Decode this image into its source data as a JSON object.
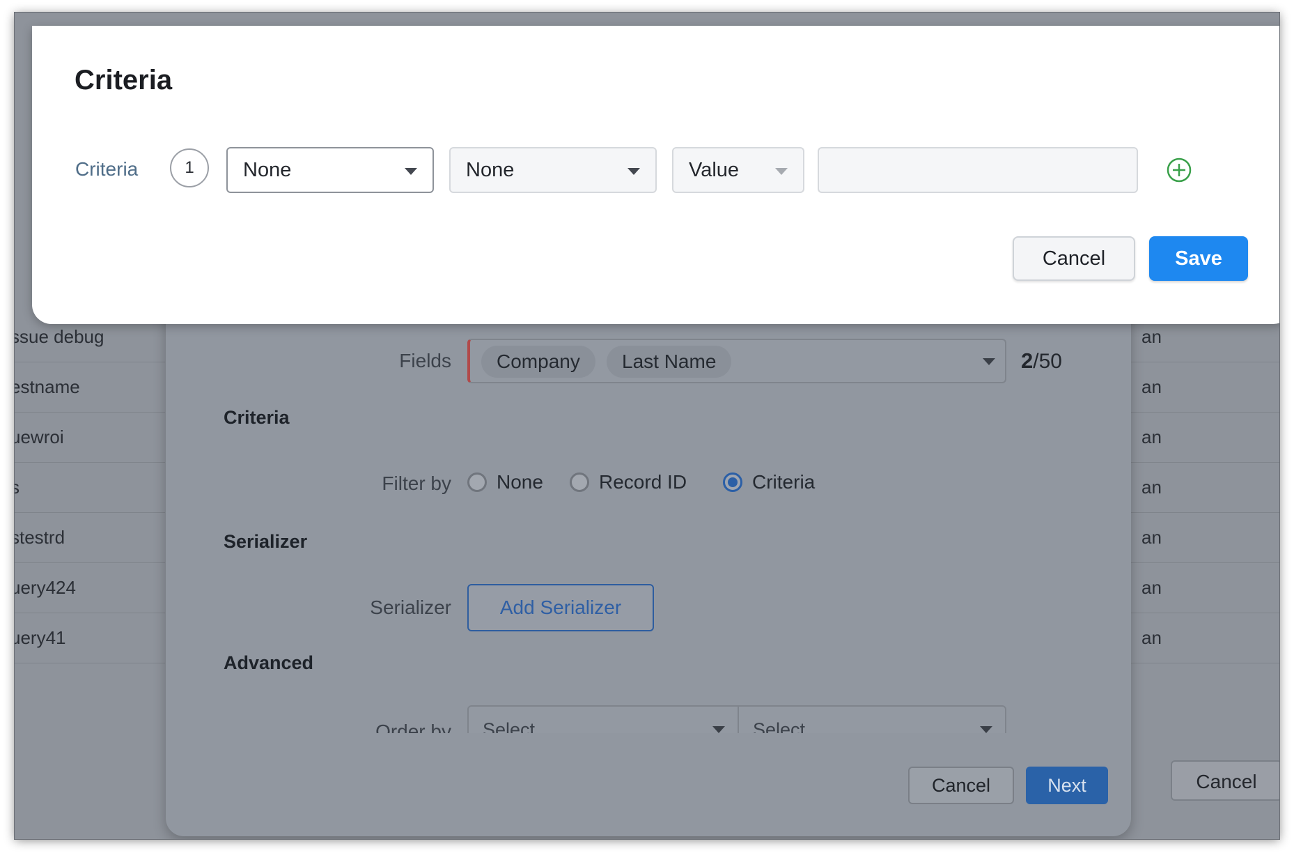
{
  "background": {
    "left_list": [
      "ssue debug",
      "estname",
      "uewroi",
      "s",
      "stestrd",
      "uery424",
      "uery41"
    ],
    "right_list": [
      "an",
      "an",
      "an",
      "an",
      "an",
      "an",
      "an"
    ],
    "cancel_label": "Cancel"
  },
  "wizard": {
    "fields_label": "Fields",
    "fields_chips": [
      "Company",
      "Last Name"
    ],
    "fields_count_selected": "2",
    "fields_count_total": "/50",
    "criteria_section": "Criteria",
    "filter_by_label": "Filter by",
    "filter_options": [
      {
        "label": "None",
        "selected": false
      },
      {
        "label": "Record ID",
        "selected": false
      },
      {
        "label": "Criteria",
        "selected": true
      }
    ],
    "serializer_section": "Serializer",
    "serializer_label": "Serializer",
    "add_serializer_label": "Add Serializer",
    "advanced_section": "Advanced",
    "order_by_label": "Order by",
    "order_by_placeholder_1": "Select",
    "order_by_placeholder_2": "Select",
    "cancel_label": "Cancel",
    "next_label": "Next"
  },
  "criteria_modal": {
    "title": "Criteria",
    "row_label": "Criteria",
    "row_number": "1",
    "field_select": "None",
    "operator_select": "None",
    "value_type_select": "Value",
    "value_input": "",
    "cancel_label": "Cancel",
    "save_label": "Save",
    "colors": {
      "accent": "#1e88f0",
      "add_icon": "#3aa04a"
    }
  }
}
